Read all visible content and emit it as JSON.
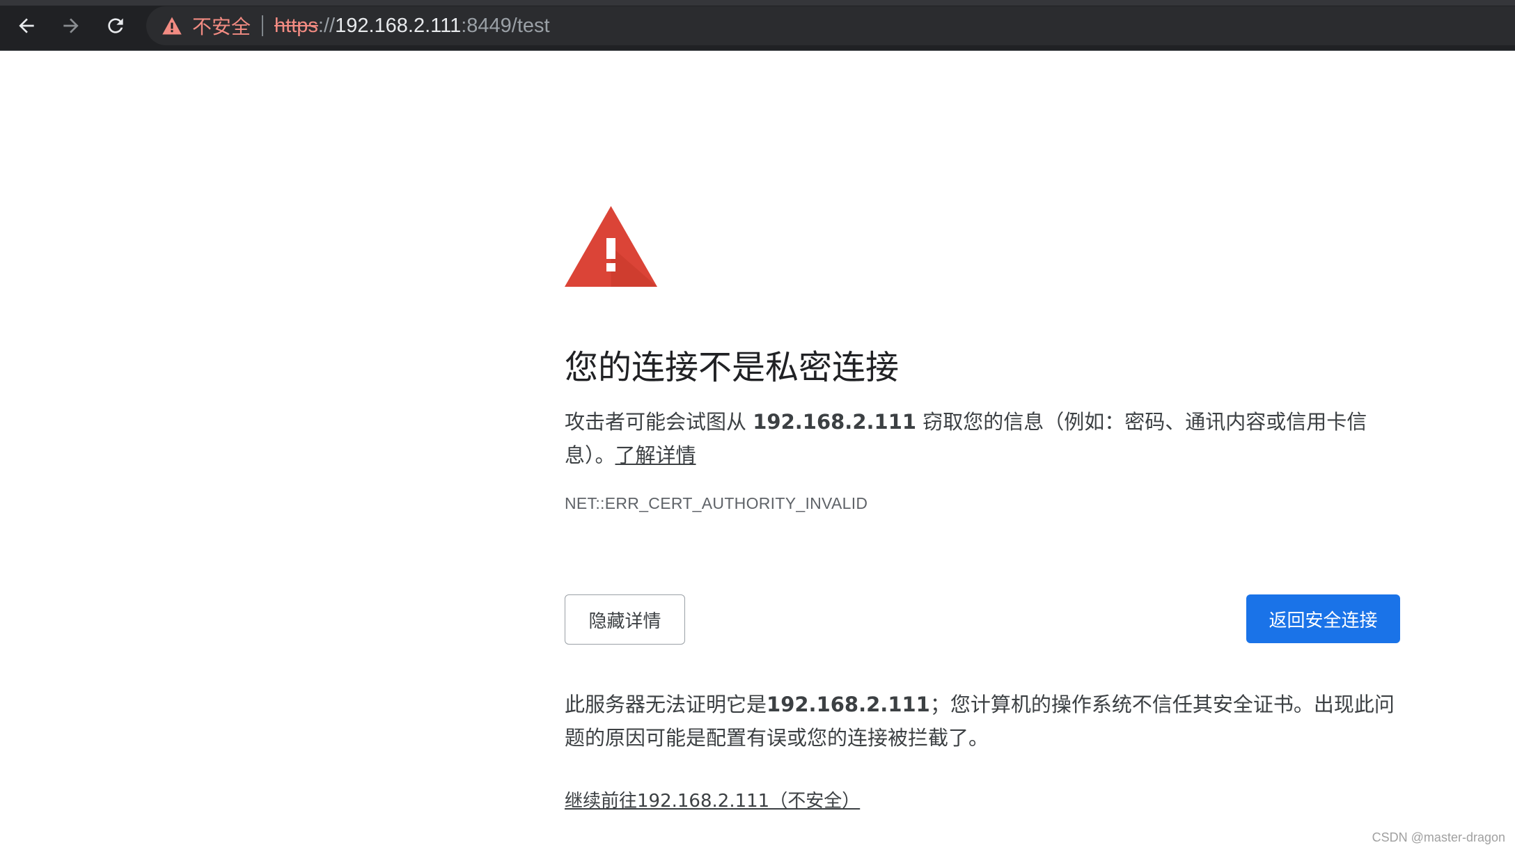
{
  "browser": {
    "security_label": "不安全",
    "url": {
      "scheme": "https",
      "slashes": "://",
      "host": "192.168.2.111",
      "rest": ":8449/test"
    },
    "icons": {
      "back": "back-arrow-icon",
      "forward": "forward-arrow-icon",
      "reload": "reload-icon",
      "security": "warning-triangle-icon"
    }
  },
  "interstitial": {
    "title": "您的连接不是私密连接",
    "description": {
      "before_host": "攻击者可能会试图从 ",
      "host": "192.168.2.111",
      "after_host": " 窃取您的信息（例如：密码、通讯内容或信用卡信息）。",
      "learn_more": "了解详情"
    },
    "error_code": "NET::ERR_CERT_AUTHORITY_INVALID",
    "hide_details_button": "隐藏详情",
    "back_to_safety_button": "返回安全连接",
    "details": {
      "before_host": "此服务器无法证明它是",
      "host": "192.168.2.111",
      "after_host": "；您计算机的操作系统不信任其安全证书。出现此问题的原因可能是配置有误或您的连接被拦截了。"
    },
    "proceed_link": "继续前往192.168.2.111（不安全）"
  },
  "watermark": "CSDN @master-dragon",
  "colors": {
    "topbar_bg": "#202124",
    "warning_red": "#db4437",
    "insecure_text": "#f28b82",
    "primary_button": "#1a73e8"
  }
}
